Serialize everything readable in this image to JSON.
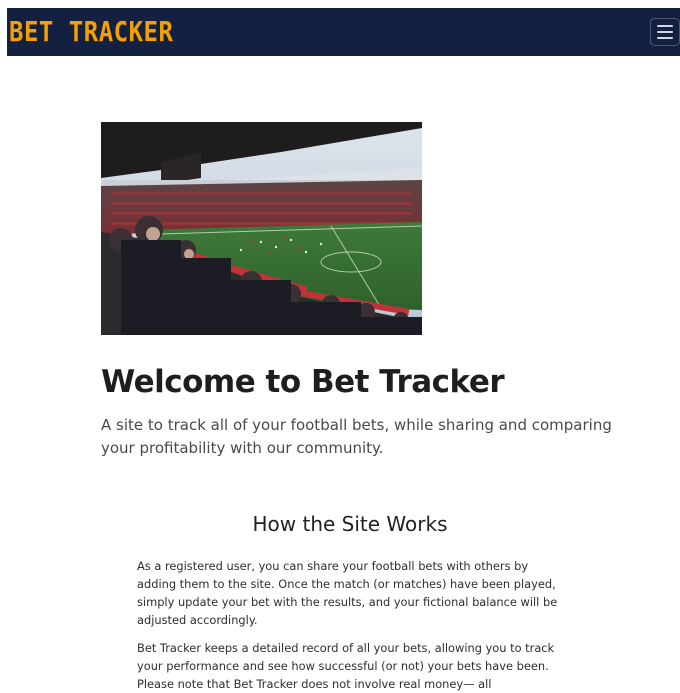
{
  "navbar": {
    "brand": "BET TRACKER",
    "toggler_icon": "hamburger-menu-icon",
    "background": "#14203f",
    "brand_color": "#f4a000"
  },
  "hero": {
    "image": "stadium-crowd-photo"
  },
  "main": {
    "title": "Welcome to Bet Tracker",
    "lead": "A site to track all of your football bets, while sharing and comparing your profitability with our community."
  },
  "how_it_works": {
    "title": "How the Site Works",
    "paragraphs": [
      "As a registered user, you can share your football bets with others by adding them to the site. Once the match (or matches) have been played, simply update your bet with the results, and your fictional balance will be adjusted accordingly.",
      "Bet Tracker keeps a detailed record of all your bets, allowing you to track your performance and see how successful (or not) your bets have been. Please note that Bet Tracker does not involve real money— all"
    ]
  }
}
